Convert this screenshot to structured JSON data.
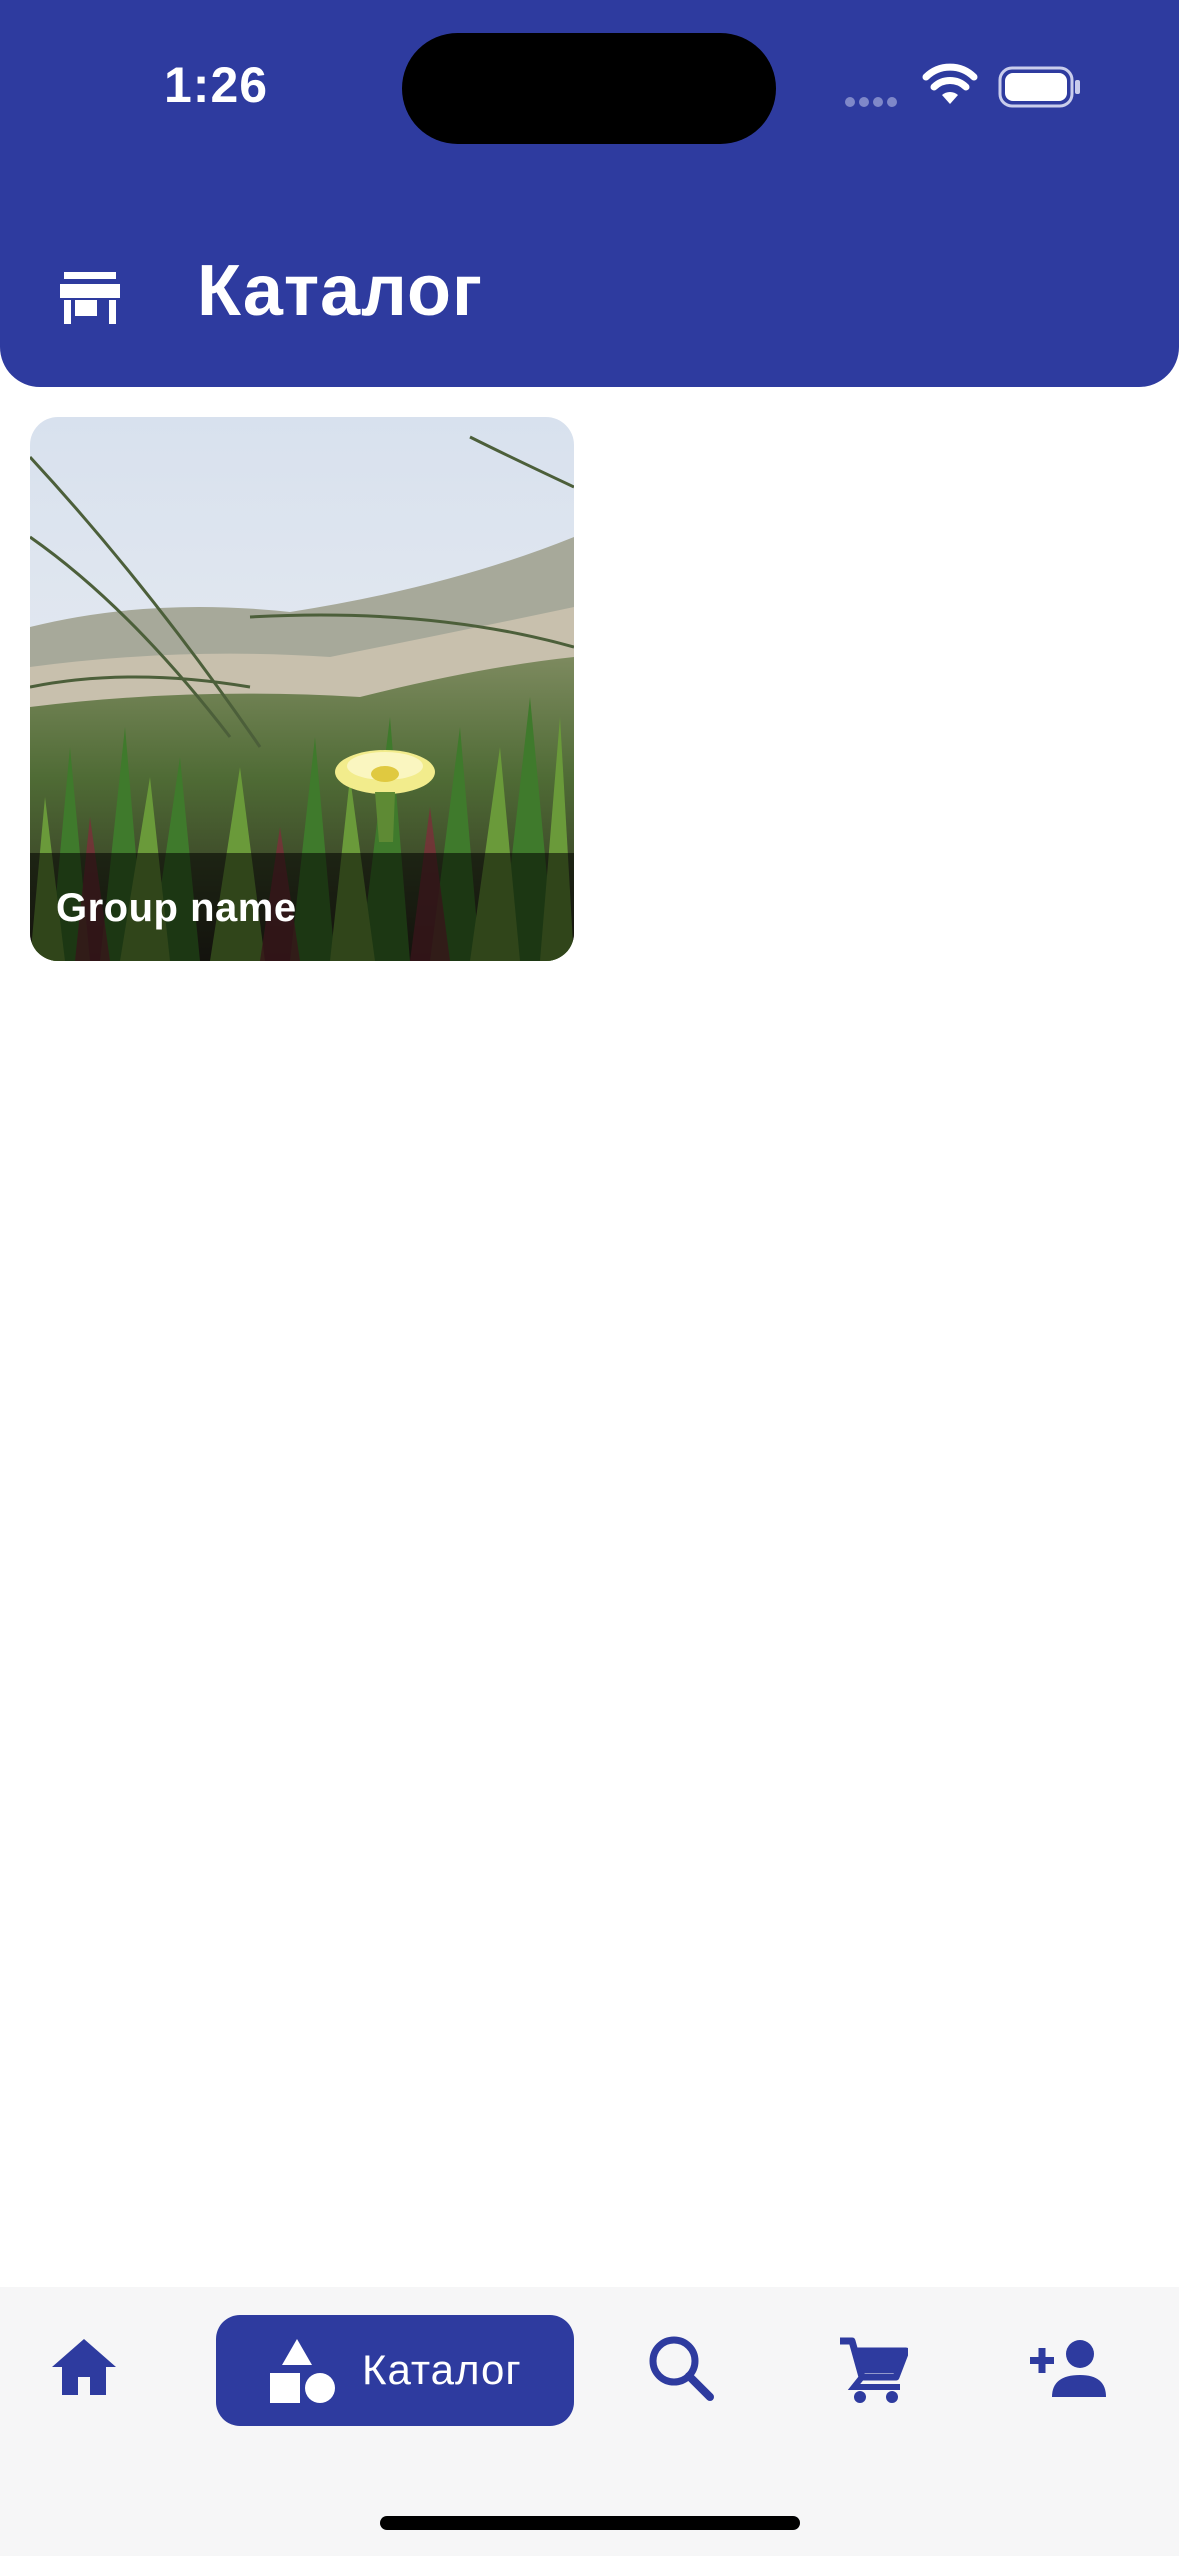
{
  "status_bar": {
    "time": "1:26",
    "icons": [
      "signal-icon",
      "wifi-icon",
      "battery-icon"
    ]
  },
  "header": {
    "title": "Каталог",
    "icon": "store-icon"
  },
  "catalog": {
    "groups": [
      {
        "name": "Group name"
      }
    ]
  },
  "bottom_nav": {
    "items": [
      {
        "id": "home",
        "icon": "home-icon",
        "label": ""
      },
      {
        "id": "catalog",
        "icon": "shapes-icon",
        "label": "Каталог",
        "selected": true
      },
      {
        "id": "search",
        "icon": "search-icon",
        "label": ""
      },
      {
        "id": "cart",
        "icon": "cart-icon",
        "label": ""
      },
      {
        "id": "account",
        "icon": "person-add-icon",
        "label": ""
      }
    ]
  },
  "colors": {
    "primary": "#2e3b9f",
    "nav_background": "#f6f6f7",
    "background": "#ffffff"
  }
}
